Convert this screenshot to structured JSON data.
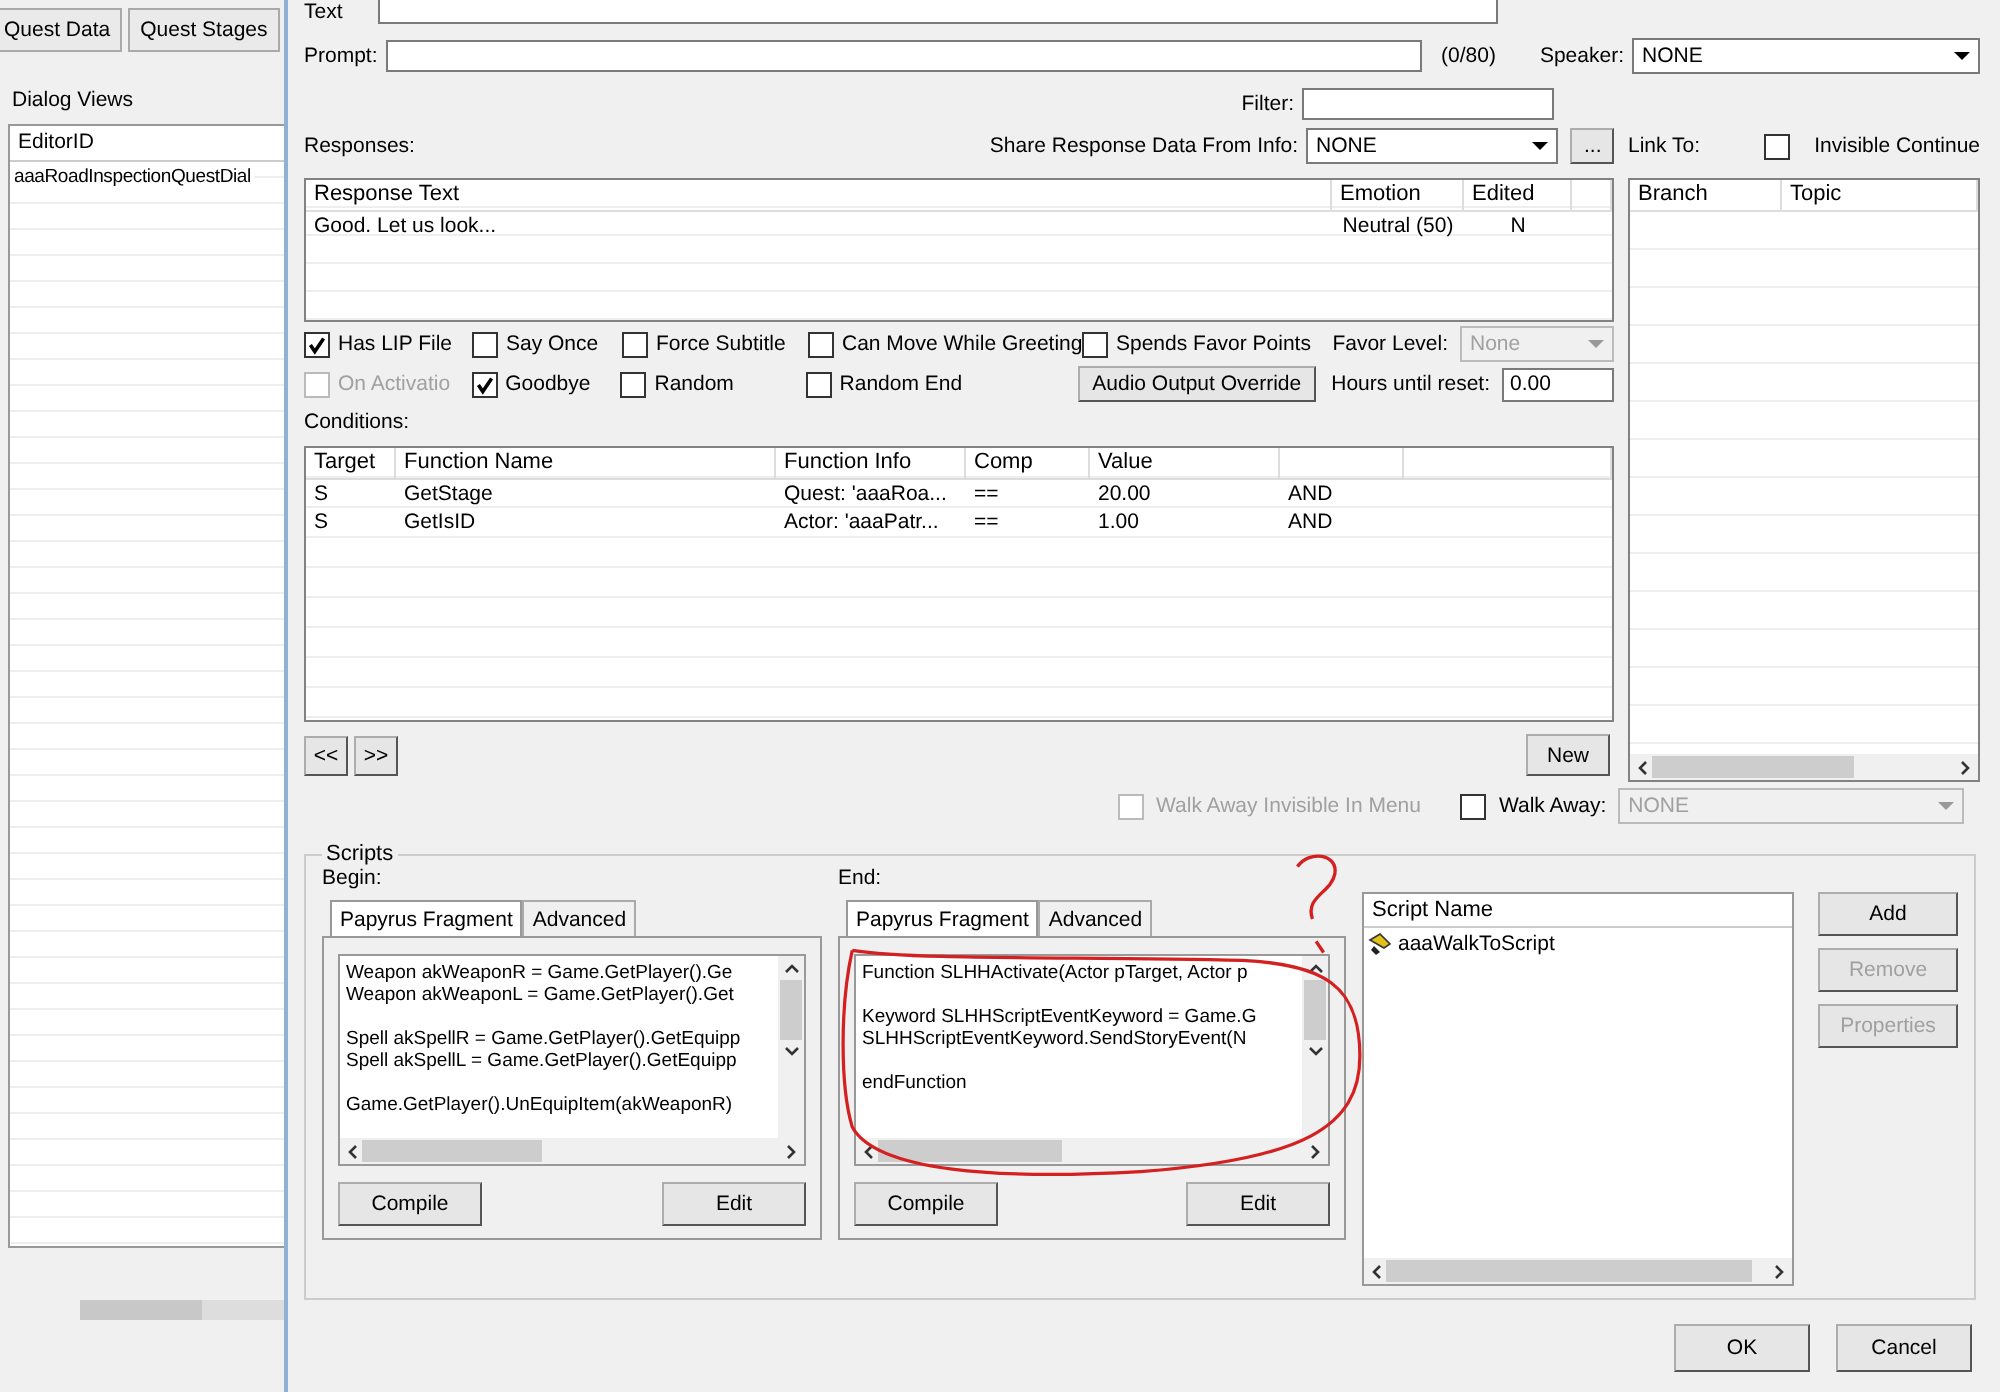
{
  "left_panel": {
    "tabs": [
      {
        "label": "Quest Data",
        "selected": false
      },
      {
        "label": "Quest Stages",
        "selected": false
      }
    ],
    "title": "Dialog Views",
    "list": {
      "columns": [
        "EditorID"
      ],
      "rows": [
        "aaaRoadInspectionQuestDial"
      ]
    }
  },
  "dialog": {
    "text_label": "Text",
    "prompt": {
      "label": "Prompt:",
      "counter": "(0/80)"
    },
    "speaker": {
      "label": "Speaker:",
      "value": "NONE"
    },
    "filter": {
      "label": "Filter:"
    },
    "responses_label": "Responses:",
    "share": {
      "label": "Share Response Data From Info:",
      "value": "NONE",
      "browse": "..."
    },
    "link_to_label": "Link To:",
    "invisible_continue": {
      "label": "Invisible Continue",
      "checked": false
    },
    "responses_table": {
      "columns": [
        "Response Text",
        "Emotion",
        "Edited"
      ],
      "rows": [
        [
          "Good. Let us look...",
          "Neutral (50)",
          "N"
        ]
      ]
    },
    "link_table": {
      "columns": [
        "Branch",
        "Topic"
      ]
    },
    "flag_rows": [
      [
        {
          "label": "Has LIP File",
          "checked": true,
          "disabled": false
        },
        {
          "label": "Say Once",
          "checked": false,
          "disabled": false
        },
        {
          "label": "Force Subtitle",
          "checked": false,
          "disabled": false
        },
        {
          "label": "Can Move While Greeting",
          "checked": false,
          "disabled": false
        },
        {
          "label": "Spends Favor Points",
          "checked": false,
          "disabled": false
        }
      ],
      [
        {
          "label": "On Activatio",
          "checked": false,
          "disabled": true
        },
        {
          "label": "Goodbye",
          "checked": true,
          "disabled": false
        },
        {
          "label": "Random",
          "checked": false,
          "disabled": false
        },
        {
          "label": "Random End",
          "checked": false,
          "disabled": false
        }
      ]
    ],
    "favor_level": {
      "label": "Favor Level:",
      "value": "None",
      "disabled": true
    },
    "audio_output_override": "Audio Output Override",
    "hours_until_reset": {
      "label": "Hours until reset:",
      "value": "0.00"
    },
    "conditions_label": "Conditions:",
    "conditions_table": {
      "columns": [
        "Target",
        "Function Name",
        "Function Info",
        "Comp",
        "Value"
      ],
      "rows": [
        [
          "S",
          "GetStage",
          "Quest: 'aaaRoa...",
          "==",
          "20.00",
          "AND"
        ],
        [
          "S",
          "GetIsID",
          "Actor: 'aaaPatr...",
          "==",
          "1.00",
          "AND"
        ]
      ]
    },
    "nav_buttons": [
      "<<",
      ">>"
    ],
    "new_button": "New",
    "walk_away_invisible": {
      "label": "Walk Away Invisible In Menu",
      "checked": false,
      "disabled": true
    },
    "walk_away": {
      "label": "Walk Away:",
      "checked": false,
      "value": "NONE",
      "disabled": true
    },
    "scripts": {
      "title": "Scripts",
      "fragments": [
        {
          "label": "Begin:",
          "tabs": [
            {
              "label": "Papyrus Fragment",
              "selected": true
            },
            {
              "label": "Advanced",
              "selected": false
            }
          ],
          "code": [
            [
              "Weapon akWeaponR = Game.GetPlayer().Ge",
              "Weapon akWeaponL = Game.GetPlayer().Get"
            ],
            [
              "Spell akSpellR = Game.GetPlayer().GetEquipp",
              "Spell akSpellL = Game.GetPlayer().GetEquipp"
            ],
            [
              "Game.GetPlayer().UnEquipItem(akWeaponR)"
            ]
          ],
          "buttons": [
            "Compile",
            "Edit"
          ]
        },
        {
          "label": "End:",
          "tabs": [
            {
              "label": "Papyrus Fragment",
              "selected": true
            },
            {
              "label": "Advanced",
              "selected": false
            }
          ],
          "code": [
            [
              "Function SLHHActivate(Actor pTarget, Actor p"
            ],
            [
              "Keyword SLHHScriptEventKeyword = Game.G",
              "SLHHScriptEventKeyword.SendStoryEvent(N"
            ],
            [
              "endFunction"
            ]
          ],
          "buttons": [
            "Compile",
            "Edit"
          ]
        }
      ],
      "list": {
        "column": "Script Name",
        "items": [
          "aaaWalkToScript"
        ]
      },
      "buttons": [
        {
          "label": "Add",
          "disabled": false
        },
        {
          "label": "Remove",
          "disabled": true
        },
        {
          "label": "Properties",
          "disabled": true
        }
      ]
    },
    "footer_buttons": [
      "OK",
      "Cancel"
    ]
  }
}
